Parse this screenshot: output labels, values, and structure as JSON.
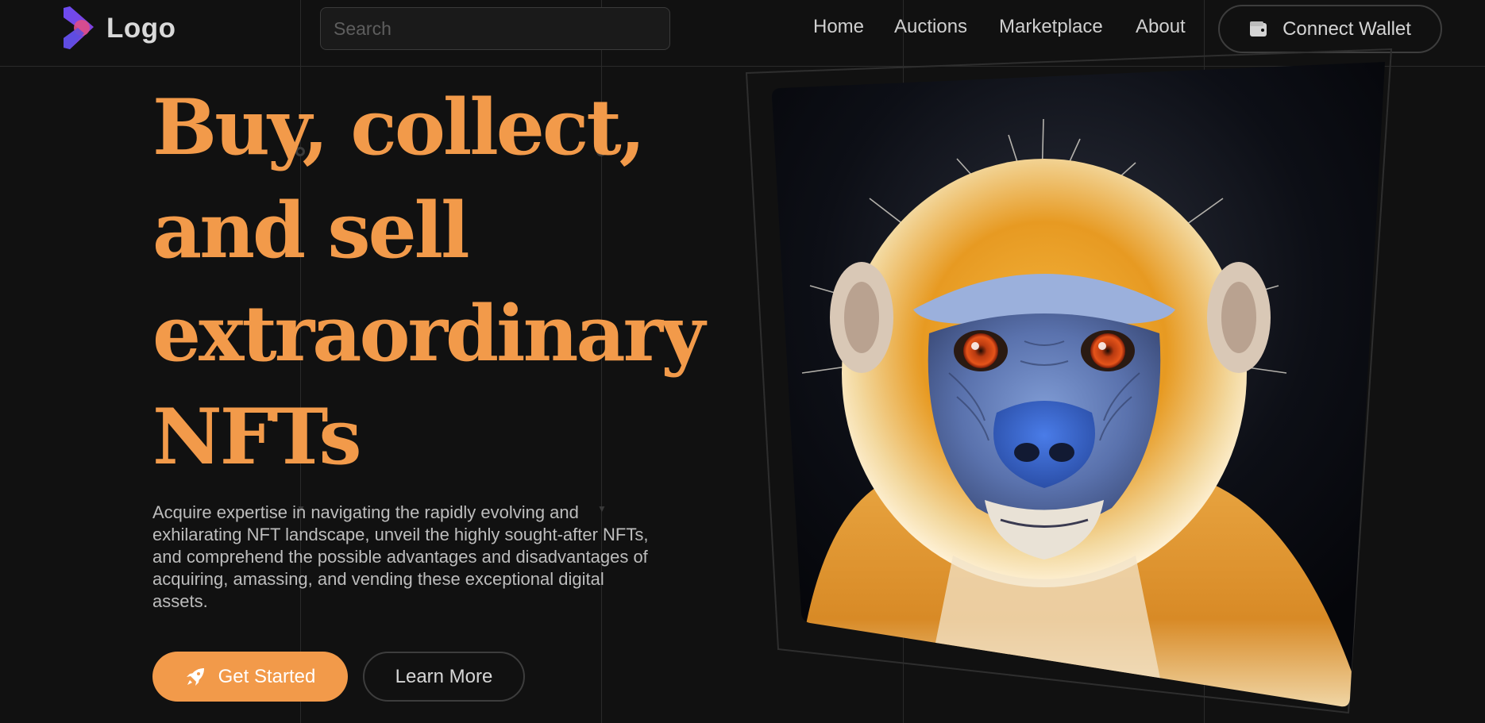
{
  "header": {
    "logo_text": "Logo",
    "search_placeholder": "Search",
    "nav": [
      {
        "label": "Home"
      },
      {
        "label": "Auctions"
      },
      {
        "label": "Marketplace"
      },
      {
        "label": "About"
      }
    ],
    "wallet_label": "Connect Wallet",
    "wallet_icon": "wallet-icon"
  },
  "hero": {
    "title_lines": [
      "Buy, collect,",
      "and sell",
      "extraordinary",
      "NFTs"
    ],
    "description": "Acquire expertise in navigating the rapidly evolving and exhilarating NFT landscape, unveil the highly sought-after NFTs, and comprehend the possible advantages and disadvantages of acquiring, amassing, and vending these exceptional digital assets.",
    "primary_button": "Get Started",
    "primary_icon": "rocket-icon",
    "secondary_button": "Learn More"
  },
  "artwork": {
    "subject": "golden monkey portrait",
    "icon": "nft-artwork-image"
  },
  "colors": {
    "background": "#111111",
    "accent": "#f29a4a",
    "border": "#3d3d3d",
    "logo_gradient_start": "#5b4de0",
    "logo_gradient_end": "#e04d86"
  }
}
